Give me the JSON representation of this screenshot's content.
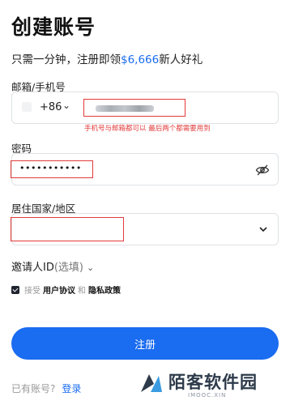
{
  "header": {
    "title": "创建账号",
    "subtitle_prefix": "只需一分钟，注册即领",
    "subtitle_amount": "$6,666",
    "subtitle_suffix": "新人好礼"
  },
  "phone": {
    "label": "邮箱/手机号",
    "country_code": "+86",
    "chevron": "⌄",
    "annotation": "手机号与邮箱都可以 最后两个都需要用到"
  },
  "password": {
    "label": "密码",
    "masked_value": "•••••••••••",
    "toggle_icon": "eye-off-icon"
  },
  "country": {
    "label": "居住国家/地区",
    "chevron_icon": "chevron-down-icon"
  },
  "invite": {
    "label": "邀请人ID",
    "optional": "(选填)",
    "chevron": "⌄"
  },
  "agreement": {
    "prefix": "接受",
    "terms": "用户协议",
    "and": "和",
    "privacy": "隐私政策"
  },
  "actions": {
    "register": "注册"
  },
  "footer": {
    "have_account": "已有账号?",
    "login": "登录"
  },
  "watermark": {
    "name": "陌客软件园",
    "domain": "IMOOC.XIN"
  },
  "colors": {
    "accent": "#1a6cf0",
    "annotation": "#e23a3a"
  }
}
